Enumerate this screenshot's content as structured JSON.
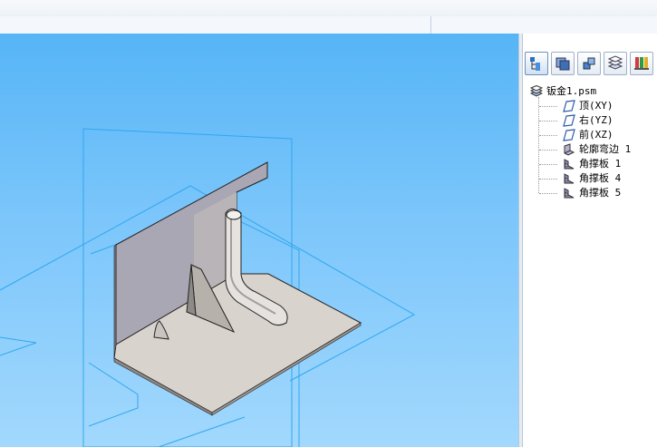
{
  "colors": {
    "viewport_top": "#56b5f6",
    "viewport_bottom": "#a2d8fd",
    "plane_line": "#2fa8ef",
    "sheet_face": "#d8d3cc",
    "wall_face": "#a9a7b3"
  },
  "panel_tabs": [
    {
      "name": "feature-tree-tab-icon"
    },
    {
      "name": "layers-tab-icon"
    },
    {
      "name": "parts-tab-icon"
    },
    {
      "name": "sheets-tab-icon"
    },
    {
      "name": "library-tab-icon"
    }
  ],
  "tree": {
    "root": {
      "label": "钣金1.psm",
      "icon": "sheetmetal-part-icon"
    },
    "items": [
      {
        "label": "顶(XY)",
        "icon": "plane-icon"
      },
      {
        "label": "右(YZ)",
        "icon": "plane-icon"
      },
      {
        "label": "前(XZ)",
        "icon": "plane-icon"
      },
      {
        "label": "轮廓弯边 1",
        "icon": "contour-flange-icon"
      },
      {
        "label": "角撑板 1",
        "icon": "gusset-icon"
      },
      {
        "label": "角撑板 4",
        "icon": "gusset-icon"
      },
      {
        "label": "角撑板 5",
        "icon": "gusset-icon"
      }
    ]
  }
}
